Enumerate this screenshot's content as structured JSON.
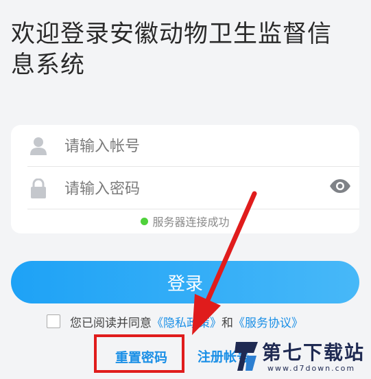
{
  "title": "欢迎登录安徽动物卫生监督信息系统",
  "account": {
    "placeholder": "请输入帐号",
    "value": ""
  },
  "password": {
    "placeholder": "请输入密码",
    "value": ""
  },
  "status": {
    "text": "服务器连接成功",
    "color": "#4fd13b"
  },
  "login_label": "登录",
  "agreement": {
    "prefix": "您已阅读并同意",
    "privacy_link": "《隐私政策》",
    "and_text": "和",
    "service_link": "《服务协议》"
  },
  "reset_label": "重置密码",
  "register_label": "注册帐号",
  "watermark": {
    "brand": "第七下载站",
    "url": "www.d7down.com"
  },
  "colors": {
    "accent": "#1a8fe6",
    "button_start": "#1ea2f6",
    "highlight": "#e01c1c"
  },
  "icons": [
    "user-icon",
    "lock-icon",
    "eye-icon"
  ]
}
